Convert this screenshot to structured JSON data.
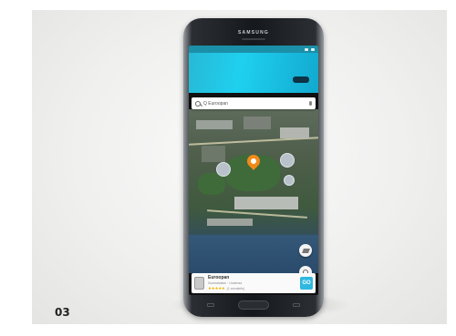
{
  "caption": "03",
  "phone": {
    "brand": "SAMSUNG"
  },
  "search": {
    "text": "Q Euroopan"
  },
  "place_card": {
    "name": "Euroopan",
    "subtitle": "Suomalaisen · Uusimaa",
    "stars": "★★★★★",
    "reviews": "(1 arvostelu)",
    "action_label": "GO"
  },
  "colors": {
    "accent": "#2fb8e0",
    "pin": "#f28a1a"
  },
  "icons": [
    "search-icon",
    "mic-icon",
    "map-pin-icon",
    "layers-icon",
    "locate-icon",
    "go-icon"
  ]
}
